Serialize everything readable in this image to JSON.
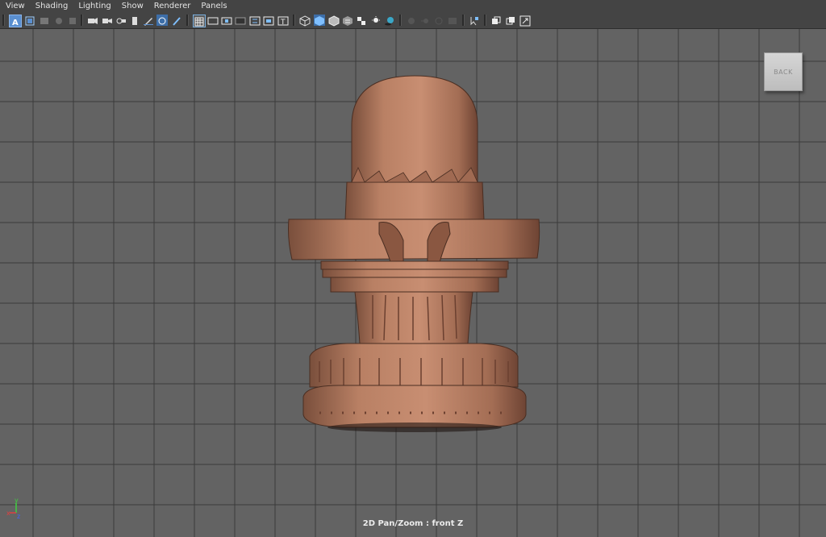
{
  "menu": [
    "View",
    "Shading",
    "Lighting",
    "Show",
    "Renderer",
    "Panels"
  ],
  "viewcube": {
    "label": "BACK"
  },
  "viewport": {
    "camera_label": "2D Pan/Zoom : front Z"
  },
  "axis": {
    "y_label": "y",
    "x_label": "x",
    "z_label": "z"
  },
  "colors": {
    "viewport_bg": "#636363",
    "model": "#b98064",
    "grid": "#3b3b3b",
    "axis_x": "#e04040",
    "axis_y": "#40d040",
    "axis_z": "#4060ff"
  },
  "toolbar_icons": [
    "select-camera-icon",
    "camera-attributes-icon",
    "bookmarks-icon",
    "image-plane-icon",
    "film-gate-icon",
    "resolution-gate-icon",
    "gate-mask-icon",
    "field-chart-icon",
    "safe-action-icon",
    "safe-title-icon",
    "wireframe-icon",
    "smooth-shade-icon",
    "shade-wireframe-icon",
    "textured-icon",
    "use-all-lights-icon",
    "shadows-icon",
    "ambient-occlusion-icon",
    "motion-blur-icon",
    "anti-aliasing-icon",
    "depth-of-field-icon",
    "xray-icon",
    "xray-joints-icon",
    "isolate-select-icon",
    "single-pane-icon",
    "two-panes-icon",
    "toggle-fullscreen-icon"
  ]
}
